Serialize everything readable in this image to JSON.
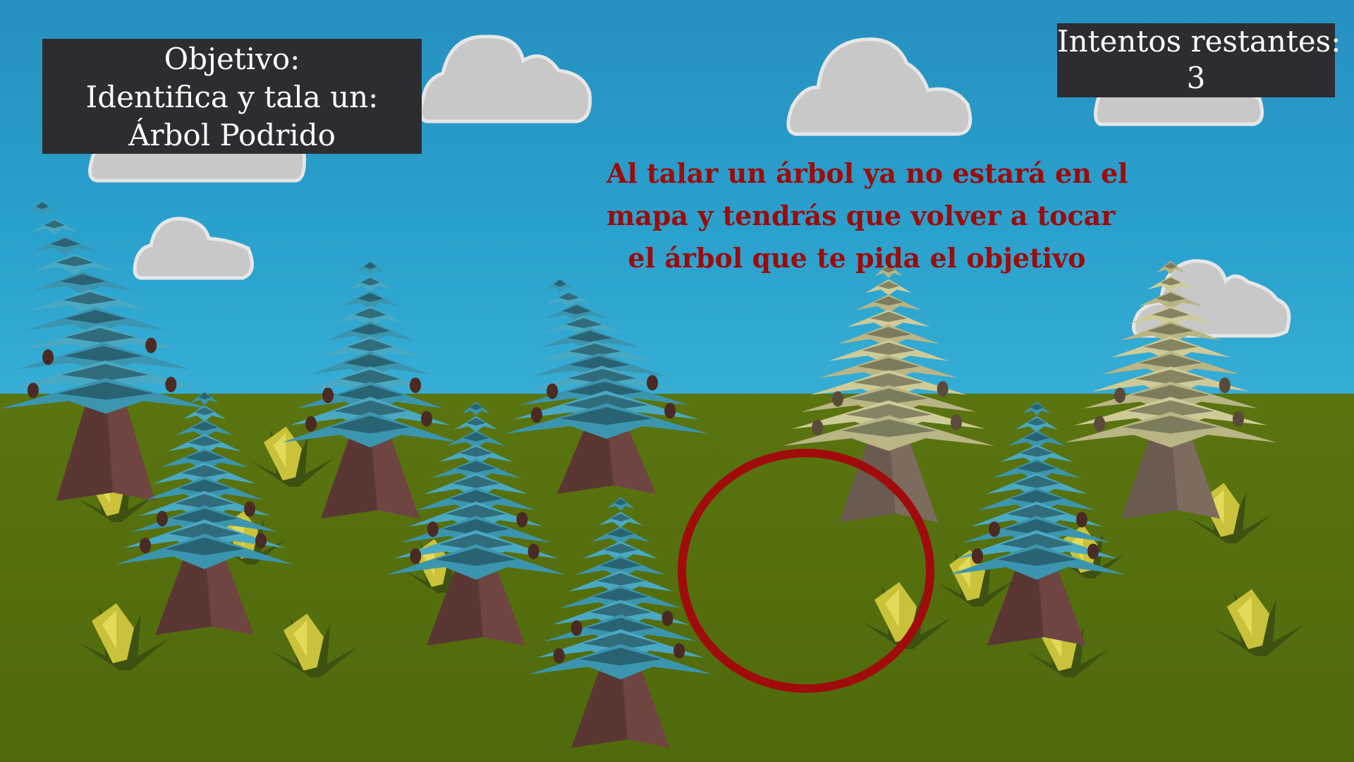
{
  "hud": {
    "objective": {
      "line1": "Objetivo:",
      "line2": "Identifica y tala un:",
      "line3": "Árbol Podrido"
    },
    "attempts": {
      "label": "Intentos restantes:",
      "value": "3"
    },
    "hint": {
      "line1": "Al talar un árbol ya no estará en el",
      "line2": "mapa y tendrás que volver a tocar",
      "line3": "el árbol que te pida el objetivo"
    }
  },
  "colors": {
    "sky": "#2a9cc4",
    "ground": "#56700f",
    "healthy_foliage": "#3d9ab3",
    "rotten_foliage": "#b8b584",
    "trunk": "#6e4540",
    "hud_panel": "#2d2d31",
    "hint_text": "#9c0a0a",
    "target_ring": "#a00b0b"
  },
  "scene": {
    "trees": [
      {
        "name": "tree-far-left-bent",
        "state": "healthy"
      },
      {
        "name": "tree-left-front",
        "state": "healthy"
      },
      {
        "name": "tree-center-left-back",
        "state": "healthy"
      },
      {
        "name": "tree-center-left-front",
        "state": "healthy"
      },
      {
        "name": "tree-center-bent",
        "state": "healthy"
      },
      {
        "name": "tree-center-front",
        "state": "healthy"
      },
      {
        "name": "tree-center-right",
        "state": "rotten"
      },
      {
        "name": "tree-right-front",
        "state": "healthy"
      },
      {
        "name": "tree-far-right",
        "state": "rotten"
      }
    ]
  }
}
